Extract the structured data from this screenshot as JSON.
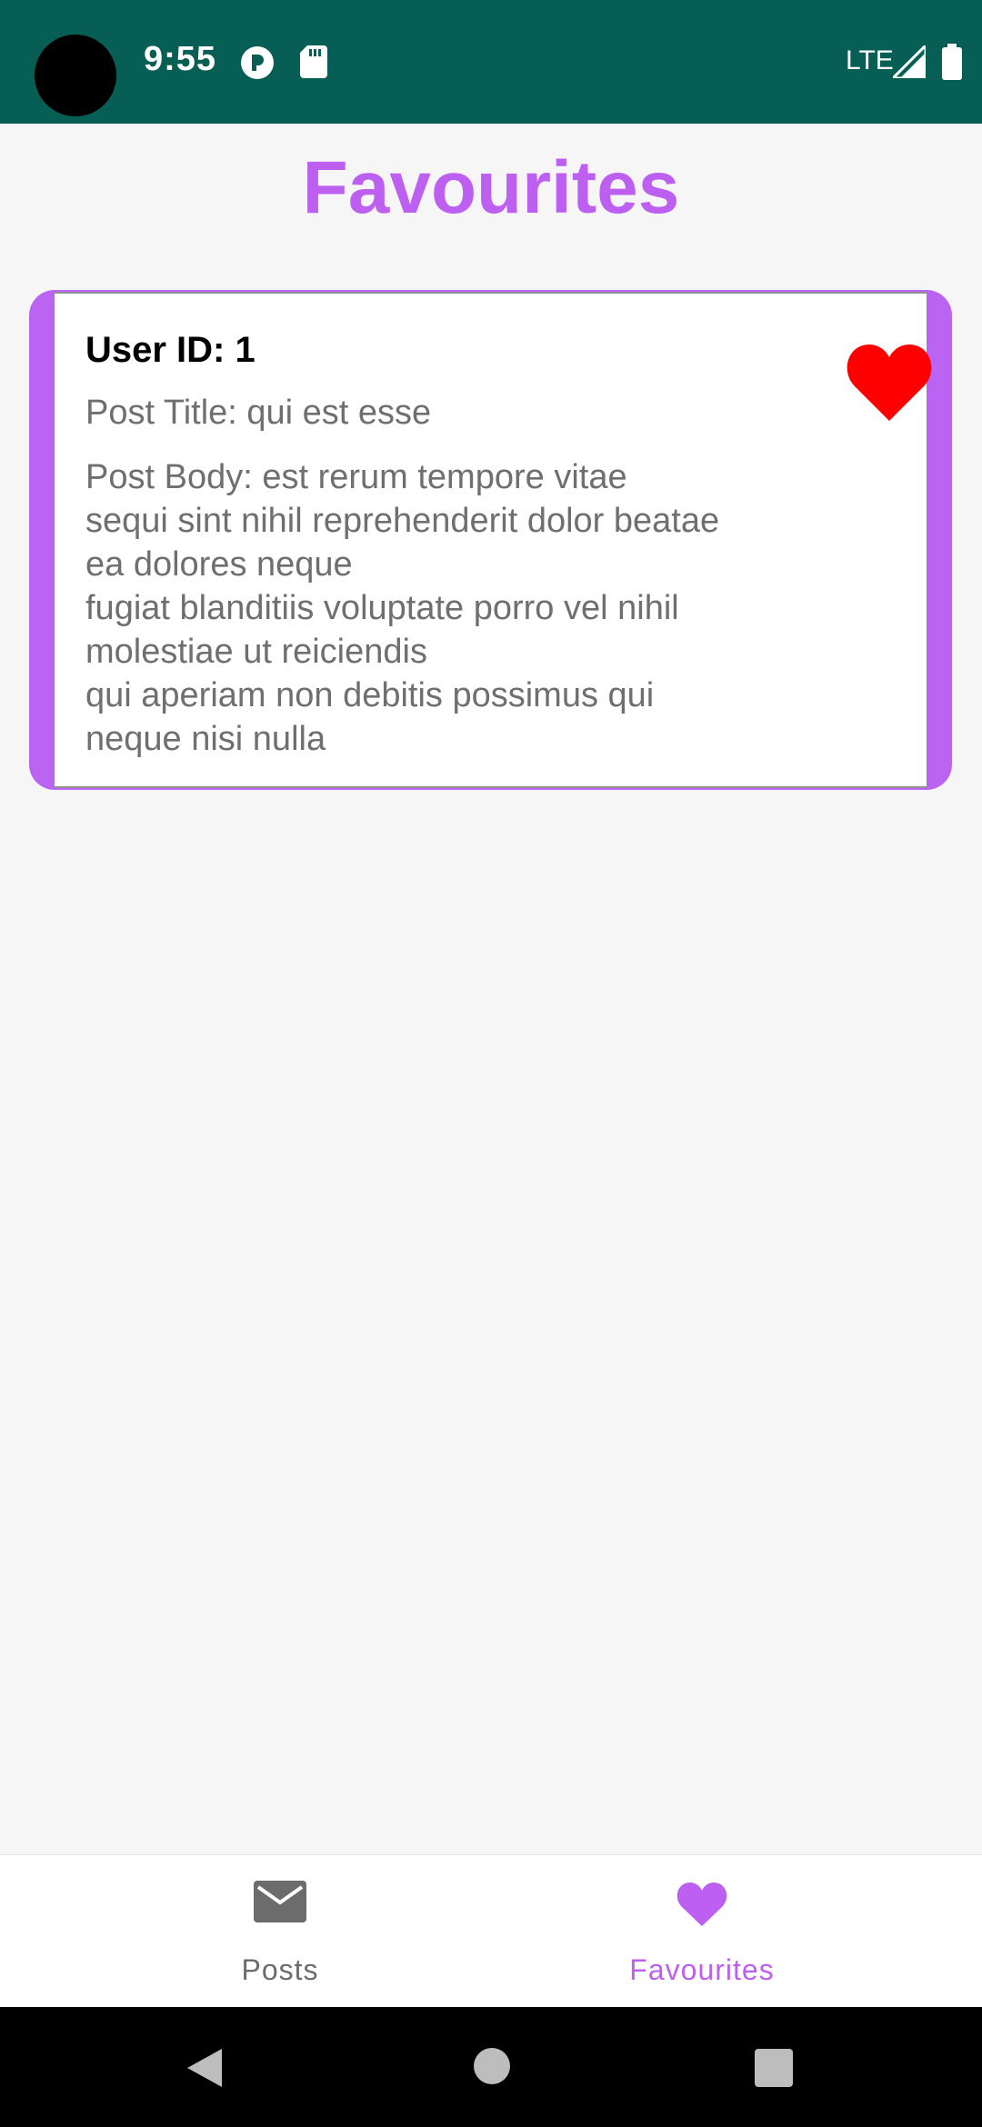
{
  "status_bar": {
    "time": "9:55",
    "network": "LTE",
    "icons": [
      "camera-cutout",
      "pocket-icon",
      "sd-card-icon",
      "signal-icon",
      "battery-icon"
    ]
  },
  "page": {
    "title": "Favourites"
  },
  "favourites": [
    {
      "user_id": "User ID: 1",
      "title": "Post Title: qui est esse",
      "body": "Post Body: est rerum tempore vitae\nsequi sint nihil reprehenderit dolor beatae\nea dolores neque\nfugiat blanditiis voluptate porro vel nihil\nmolestiae ut reiciendis\nqui aperiam non debitis possimus qui\nneque nisi nulla",
      "favourite_icon": "heart-icon",
      "favourite_color": "#ff0000"
    }
  ],
  "bottom_nav": {
    "items": [
      {
        "label": "Posts",
        "icon": "mail-icon",
        "selected": false
      },
      {
        "label": "Favourites",
        "icon": "heart-icon",
        "selected": true
      }
    ]
  },
  "colors": {
    "accent": "#bd5ff0",
    "status_bar": "#075e54",
    "heart": "#ff0000"
  },
  "system_nav": {
    "buttons": [
      "back-icon",
      "home-icon",
      "recents-icon"
    ]
  }
}
